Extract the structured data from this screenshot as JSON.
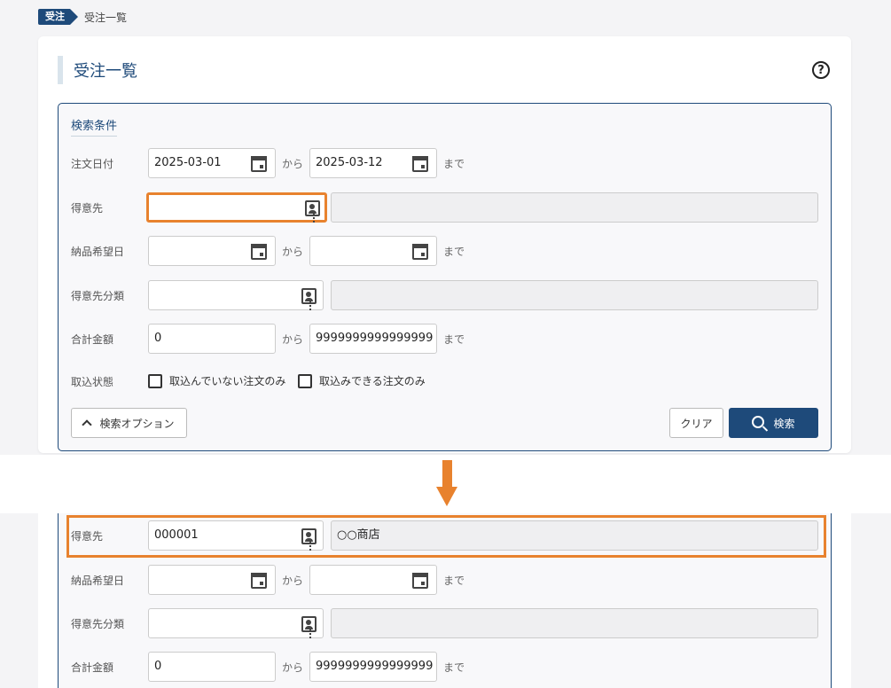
{
  "breadcrumb": {
    "badge": "受注",
    "current": "受注一覧"
  },
  "page": {
    "title": "受注一覧",
    "help": "?"
  },
  "search": {
    "title": "検索条件",
    "order_date": {
      "label": "注文日付",
      "from": "2025-03-01",
      "to": "2025-03-12"
    },
    "customer": {
      "label": "得意先",
      "code": "",
      "name": ""
    },
    "delivery_date": {
      "label": "納品希望日",
      "from": "",
      "to": ""
    },
    "customer_class": {
      "label": "得意先分類",
      "code": "",
      "name": ""
    },
    "total_amount": {
      "label": "合計金額",
      "from": "0",
      "to": "9999999999999999"
    },
    "import_status": {
      "label": "取込状態",
      "options": [
        {
          "label": "取込んでいない注文のみ",
          "checked": false
        },
        {
          "label": "取込みできる注文のみ",
          "checked": false
        }
      ]
    },
    "range_from": "から",
    "range_to": "まで",
    "options_button": "検索オプション",
    "clear_button": "クリア",
    "search_button": "検索"
  },
  "after": {
    "customer": {
      "label": "得意先",
      "code": "000001",
      "name": "○○商店"
    },
    "delivery_date": {
      "label": "納品希望日",
      "from": "",
      "to": ""
    },
    "customer_class": {
      "label": "得意先分類",
      "code": "",
      "name": ""
    },
    "total_amount": {
      "label": "合計金額",
      "from": "0",
      "to": "9999999999999999"
    }
  },
  "colors": {
    "accent": "#1e4a7a",
    "highlight": "#e8822e"
  }
}
